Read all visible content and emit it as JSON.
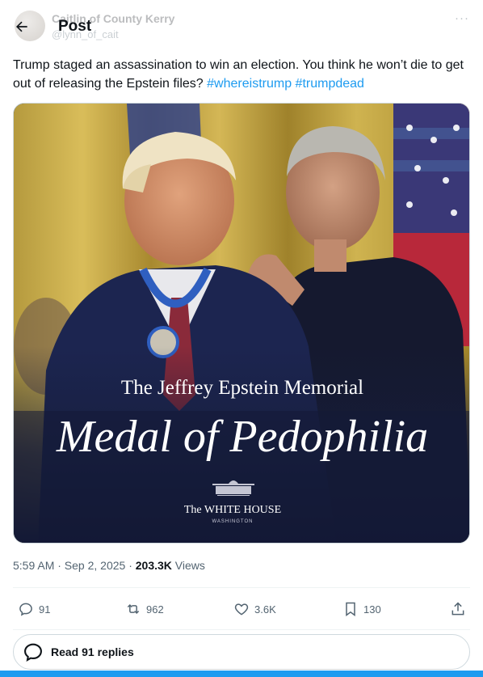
{
  "header": {
    "title": "Post",
    "author_name": "Caitlin of County Kerry",
    "author_handle": "@lynn_of_cait",
    "more_label": "···"
  },
  "tweet": {
    "text_before": "Trump staged an assassination to win an election. You think he won’t die to get out of releasing the Epstein files? ",
    "hashtag_1": "#whereistrump",
    "hashtag_2": "#trumpdead"
  },
  "media": {
    "caption_line1": "The Jeffrey Epstein Memorial",
    "caption_line2": "Medal of Pedophilia",
    "logo_line1": "The WHITE HOUSE",
    "logo_line2": "WASHINGTON"
  },
  "meta": {
    "time": "5:59 AM · Sep 2, 2025 · ",
    "views_count": "203.3K",
    "views_label": " Views"
  },
  "actions": {
    "replies": "91",
    "reposts": "962",
    "likes": "3.6K",
    "bookmarks": "130"
  },
  "read_replies": {
    "label": "Read 91 replies"
  },
  "colors": {
    "accent": "#1d9bf0",
    "text": "#0f1419",
    "muted": "#536471"
  }
}
